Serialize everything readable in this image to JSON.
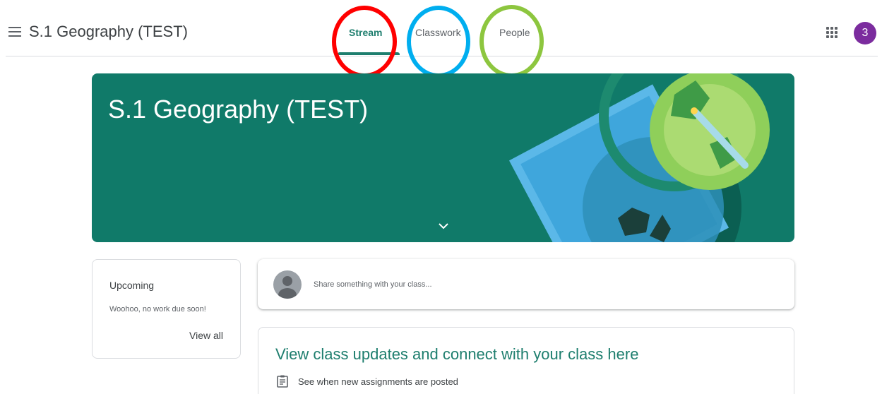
{
  "header": {
    "menu_icon": "hamburger-menu-icon",
    "title": "S.1 Geography (TEST)",
    "apps_icon": "google-apps-grid-icon",
    "avatar_initial": "3",
    "avatar_color": "#7b2c9e"
  },
  "tabs": [
    {
      "label": "Stream",
      "active": true
    },
    {
      "label": "Classwork",
      "active": false
    },
    {
      "label": "People",
      "active": false
    }
  ],
  "annotations": {
    "circle_colors": [
      "#ff0000",
      "#00aeef",
      "#8dc63f"
    ]
  },
  "banner": {
    "title": "S.1 Geography (TEST)",
    "background_color": "#107a69",
    "expand_icon": "chevron-down-icon"
  },
  "upcoming": {
    "title": "Upcoming",
    "message": "Woohoo, no work due soon!",
    "link": "View all"
  },
  "share": {
    "placeholder": "Share something with your class..."
  },
  "updates": {
    "title": "View class updates and connect with your class here",
    "items": [
      {
        "icon": "assignment-icon",
        "text": "See when new assignments are posted"
      }
    ]
  }
}
